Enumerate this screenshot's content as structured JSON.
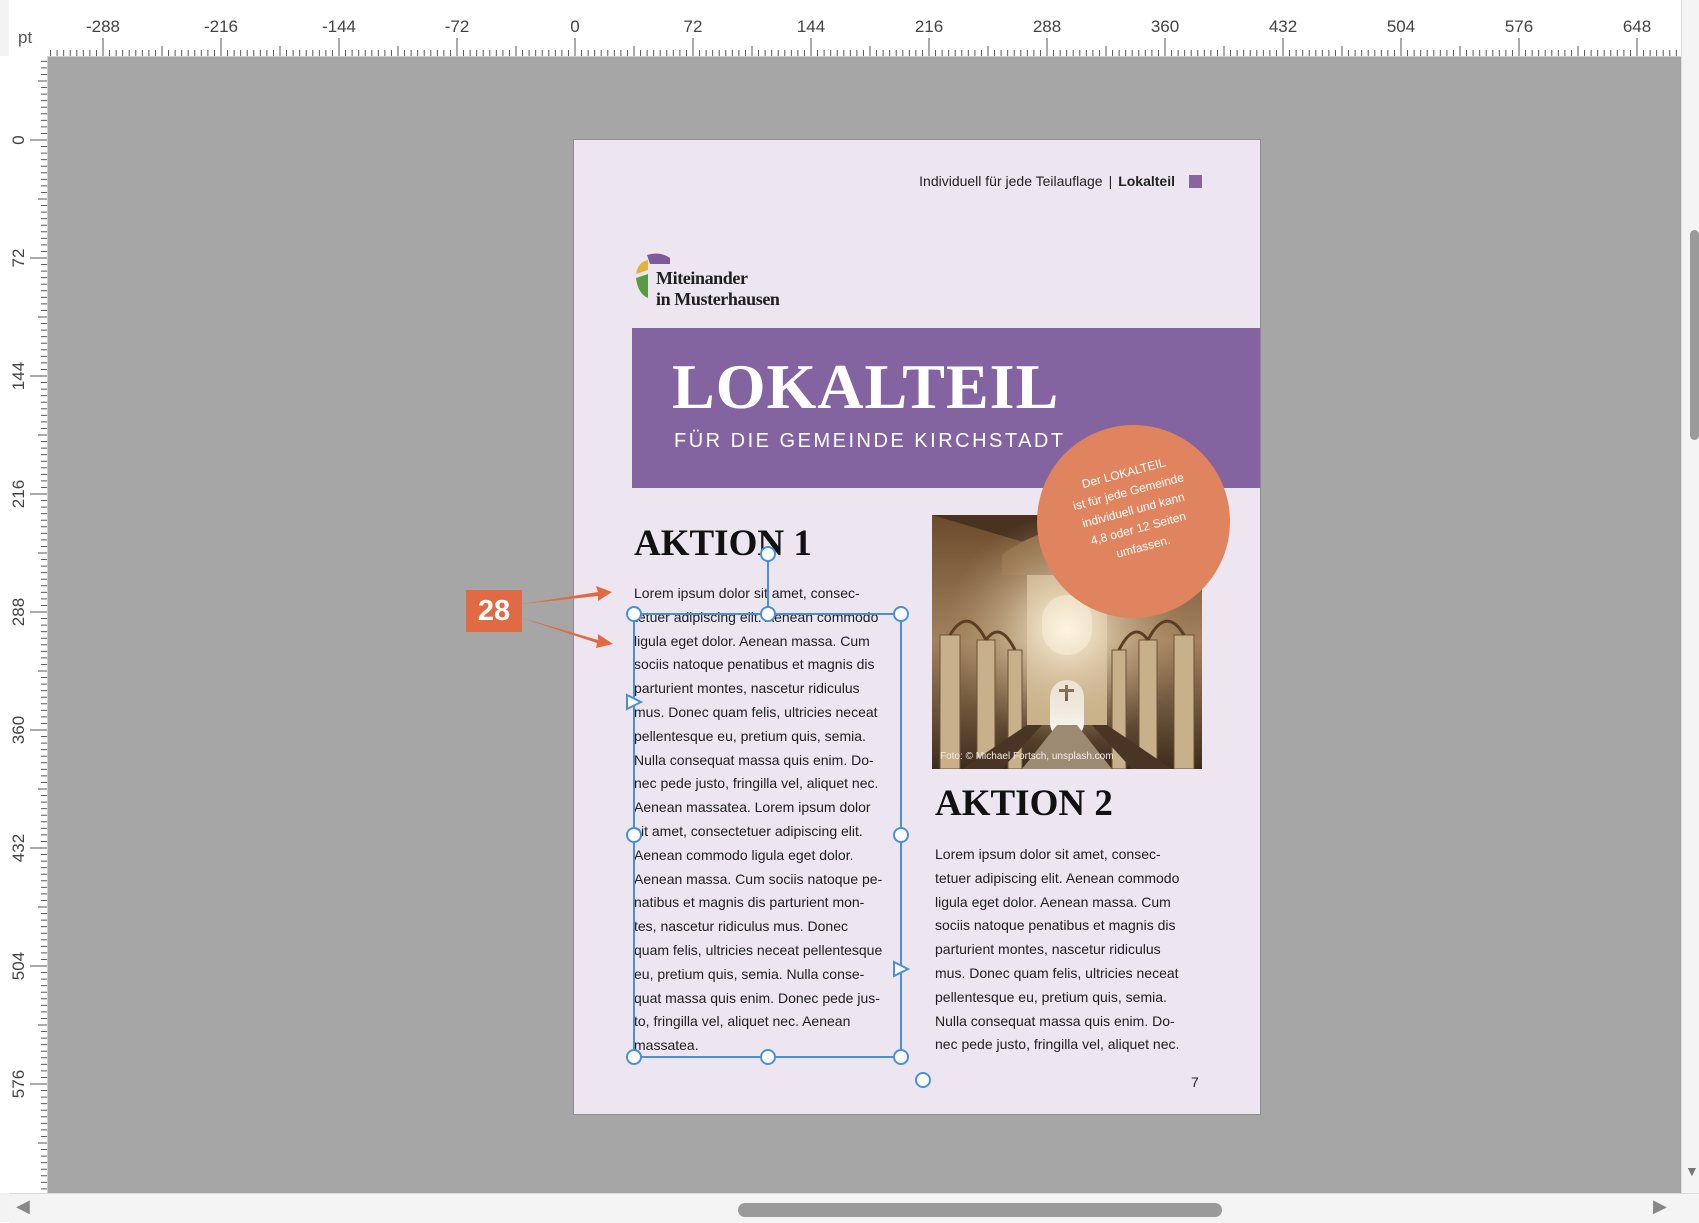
{
  "ruler": {
    "unit": "pt",
    "horizontal_labels": [
      "-288",
      "-216",
      "-144",
      "-72",
      "0",
      "72",
      "144",
      "216",
      "288",
      "360",
      "432",
      "504",
      "576",
      "648"
    ],
    "vertical_labels": [
      "0",
      "72",
      "144",
      "216",
      "288",
      "360",
      "432",
      "504",
      "576"
    ]
  },
  "page": {
    "running_head_text": "Individuell für jede Teilauflage",
    "running_head_separator": "|",
    "running_head_bold": "Lokalteil",
    "logo_line1": "Miteinander",
    "logo_line2": "in Musterhausen",
    "banner_title": "LOKALTEIL",
    "banner_subtitle": "FÜR DIE GEMEINDE KIRCHSTADT",
    "badge_lines": [
      "Der LOKALTEIL",
      "ist für jede Gemeinde",
      "individuell und kann",
      "4,8 oder 12 Seiten",
      "umfassen."
    ],
    "photo_credit": "Foto: © Michael Fortsch, unsplash.com",
    "aktion1_heading": "AKTION 1",
    "aktion1_lines": [
      "Lorem ipsum dolor sit amet, consec-",
      "tetuer adipiscing elit. Aenean commodo",
      "ligula eget dolor. Aenean massa. Cum",
      "sociis natoque penatibus et magnis dis",
      "parturient montes, nascetur ridiculus",
      "mus. Donec quam felis, ultricies neceat",
      "pellentesque eu, pretium quis, semia.",
      "Nulla consequat massa quis enim. Do-",
      "nec pede justo, fringilla vel, aliquet nec.",
      "Aenean massatea. Lorem ipsum dolor",
      "sit amet, consectetuer adipiscing elit.",
      "Aenean commodo ligula eget dolor.",
      "Aenean massa. Cum sociis natoque pe-",
      "natibus et magnis dis parturient mon-",
      "tes, nascetur ridiculus mus. Donec",
      "quam felis, ultricies neceat pellentesque",
      "eu, pretium quis, semia. Nulla conse-",
      "quat massa quis enim. Donec pede jus-",
      "to, fringilla vel, aliquet nec. Aenean",
      "massatea."
    ],
    "aktion2_heading": "AKTION 2",
    "aktion2_lines": [
      "Lorem ipsum dolor sit amet, consec-",
      "tetuer adipiscing elit. Aenean commodo",
      "ligula eget dolor. Aenean massa. Cum",
      "sociis natoque penatibus et magnis dis",
      "parturient montes, nascetur ridiculus",
      "mus. Donec quam felis, ultricies neceat",
      "pellentesque eu, pretium quis, semia.",
      "Nulla consequat massa quis enim. Do-",
      "nec pede justo, fringilla vel, aliquet nec."
    ],
    "page_number": "7"
  },
  "callout": {
    "number": "28"
  },
  "colors": {
    "pasteboard": "#a6a6a6",
    "page_background": "#ede6f0",
    "banner": "#8464a0",
    "badge": "#e0835f",
    "callout": "#e06a43",
    "selection": "#4a90d9"
  },
  "scrollbars": {
    "left_arrow": "◀",
    "right_arrow": "▶",
    "down_arrow": "▼"
  }
}
